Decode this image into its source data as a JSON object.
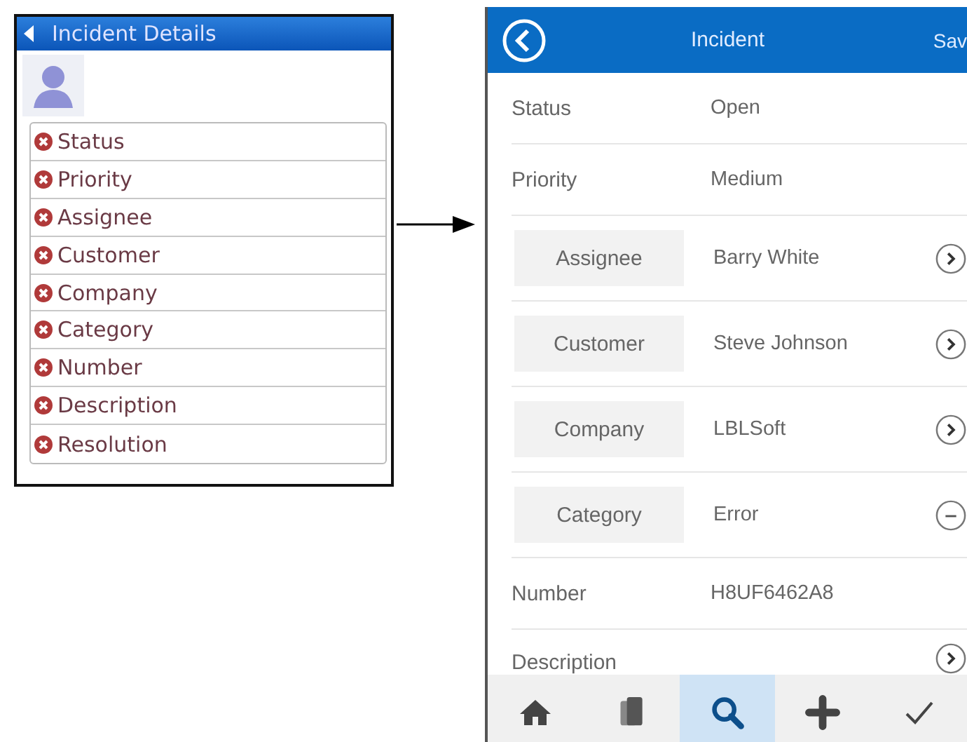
{
  "designer": {
    "title": "Incident Details",
    "fields": [
      {
        "label": "Status"
      },
      {
        "label": "Priority"
      },
      {
        "label": "Assignee"
      },
      {
        "label": "Customer"
      },
      {
        "label": "Company"
      },
      {
        "label": "Category"
      },
      {
        "label": "Number"
      },
      {
        "label": "Description"
      },
      {
        "label": "Resolution"
      }
    ]
  },
  "phone": {
    "title": "Incident",
    "action": "Sav",
    "rows": [
      {
        "kind": "plain",
        "label": "Status",
        "value": "Open",
        "navigable": false,
        "clearable": false
      },
      {
        "kind": "plain",
        "label": "Priority",
        "value": "Medium",
        "navigable": false,
        "clearable": false
      },
      {
        "kind": "lookup",
        "label": "Assignee",
        "value": "Barry White",
        "navigable": true,
        "clearable": false
      },
      {
        "kind": "lookup",
        "label": "Customer",
        "value": "Steve Johnson",
        "navigable": true,
        "clearable": false
      },
      {
        "kind": "lookup",
        "label": "Company",
        "value": "LBLSoft",
        "navigable": true,
        "clearable": false
      },
      {
        "kind": "lookup",
        "label": "Category",
        "value": "Error",
        "navigable": false,
        "clearable": true
      },
      {
        "kind": "plain",
        "label": "Number",
        "value": "H8UF6462A8",
        "navigable": false,
        "clearable": false
      },
      {
        "kind": "plain",
        "label": "Description",
        "navigable": true,
        "clearable": false
      }
    ],
    "tabs": [
      {
        "kind": "home",
        "selected": false
      },
      {
        "kind": "pages",
        "selected": false
      },
      {
        "kind": "search",
        "selected": true
      },
      {
        "kind": "add",
        "selected": false
      },
      {
        "kind": "done",
        "selected": false
      }
    ]
  }
}
